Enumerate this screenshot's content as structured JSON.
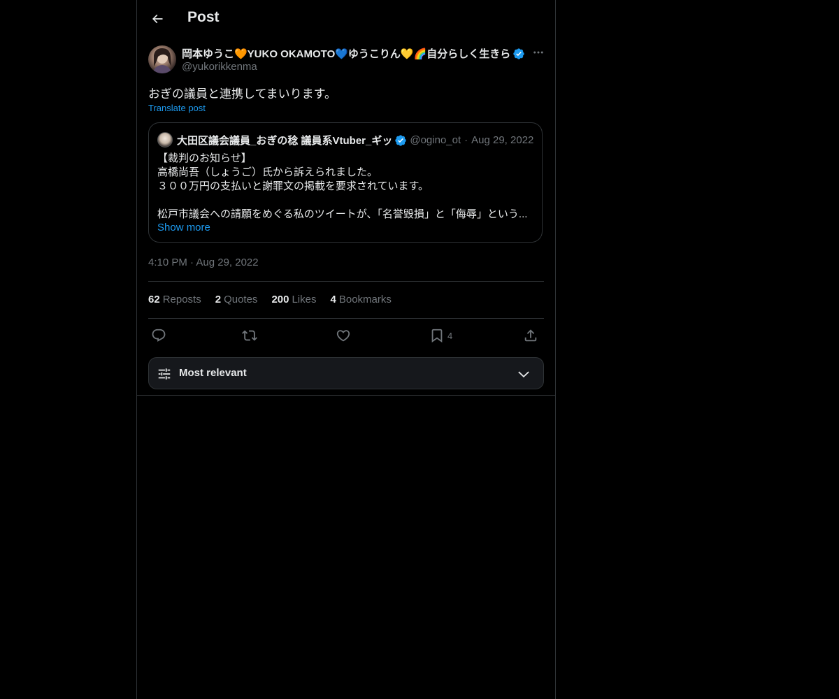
{
  "header": {
    "title": "Post",
    "back_icon": "arrow-left-icon"
  },
  "post": {
    "author_name": "岡本ゆうこ🧡YUKO OKAMOTO💙ゆうこりん💛🌈自分らしく生きら",
    "author_handle": "@yukorikkenma",
    "verified": true,
    "text": "おぎの議員と連携してまいります。",
    "translate_label": "Translate post",
    "timestamp": "4:10 PM · Aug 29, 2022"
  },
  "quote": {
    "name": "大田区議会議員_おぎの稔 議員系Vtuber_ギッ",
    "handle": "@ogino_ot",
    "separator": "·",
    "date": "Aug 29, 2022",
    "lines": [
      "【裁判のお知らせ】",
      "高橋尚吾（しょうご）氏から訴えられました。",
      "３００万円の支払いと謝罪文の掲載を要求されています。",
      "",
      "松戸市議会への請願をめぐる私のツイートが、「名誉毀損」と「侮辱」という..."
    ],
    "show_more": "Show more"
  },
  "stats": [
    {
      "count": "62",
      "label": "Reposts"
    },
    {
      "count": "2",
      "label": "Quotes"
    },
    {
      "count": "200",
      "label": "Likes"
    },
    {
      "count": "4",
      "label": "Bookmarks"
    }
  ],
  "actions": {
    "reply_icon": "reply-icon",
    "repost_icon": "repost-icon",
    "like_icon": "heart-icon",
    "bookmark_icon": "bookmark-icon",
    "bookmark_count": "4",
    "share_icon": "share-icon"
  },
  "sort": {
    "label": "Most relevant",
    "icon": "sliders-icon",
    "chevron": "chevron-down-icon"
  },
  "colors": {
    "background": "#000000",
    "accent": "#1d9bf0",
    "text_primary": "#e7e9ea",
    "text_secondary": "#71767b",
    "border": "#2f3336"
  }
}
